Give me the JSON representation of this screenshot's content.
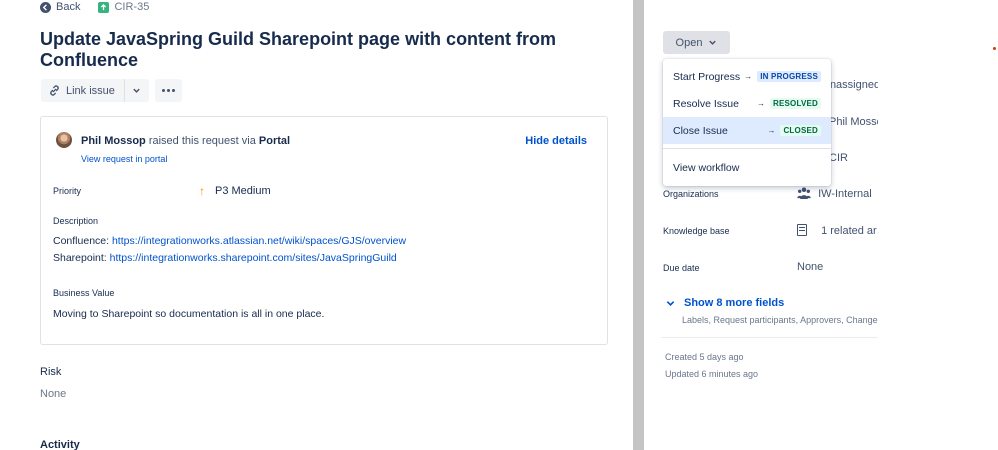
{
  "nav": {
    "back_label": "Back",
    "issue_key": "CIR-35"
  },
  "issue": {
    "title": "Update JavaSpring Guild Sharepoint page with content from Confluence"
  },
  "actions": {
    "link_issue_label": "Link issue"
  },
  "request": {
    "reporter": "Phil Mossop",
    "raised_text": " raised this request via ",
    "channel": "Portal",
    "view_link": "View request in portal",
    "hide_details": "Hide details"
  },
  "fields": {
    "priority_label": "Priority",
    "priority_value": "P3 Medium",
    "description_label": "Description",
    "description_lines": [
      {
        "prefix": "Confluence: ",
        "link": "https://integrationworks.atlassian.net/wiki/spaces/GJS/overview"
      },
      {
        "prefix": "Sharepoint: ",
        "link": "https://integrationworks.sharepoint.com/sites/JavaSpringGuild"
      }
    ],
    "business_value_label": "Business Value",
    "business_value": "Moving to Sharepoint so documentation is all in one place.",
    "risk_label": "Risk",
    "risk_value": "None",
    "activity_label": "Activity"
  },
  "sidebar": {
    "status_label": "Open",
    "assignee_value": "Unassigned",
    "reporter_value": "Phil Mossop",
    "request_type_value": "CIR",
    "organizations_label": "Organizations",
    "organizations_value": "IW-Internal",
    "knowledge_base_label": "Knowledge base",
    "knowledge_base_value": "1 related ar",
    "due_date_label": "Due date",
    "due_date_value": "None",
    "show_more_label": "Show 8 more fields",
    "show_more_sub": "Labels, Request participants, Approvers, Change",
    "created": "Created 5 days ago",
    "updated": "Updated 6 minutes ago"
  },
  "transitions": [
    {
      "label": "Start Progress",
      "target": "IN PROGRESS",
      "color": "#0747a6"
    },
    {
      "label": "Resolve Issue",
      "target": "RESOLVED",
      "color": "#006644"
    },
    {
      "label": "Close Issue",
      "target": "CLOSED",
      "color": "#006644"
    }
  ],
  "view_workflow_label": "View workflow",
  "colors": {
    "link": "#0052cc",
    "text": "#172b4d",
    "muted": "#6b778c",
    "priority": "#ff8b00"
  }
}
